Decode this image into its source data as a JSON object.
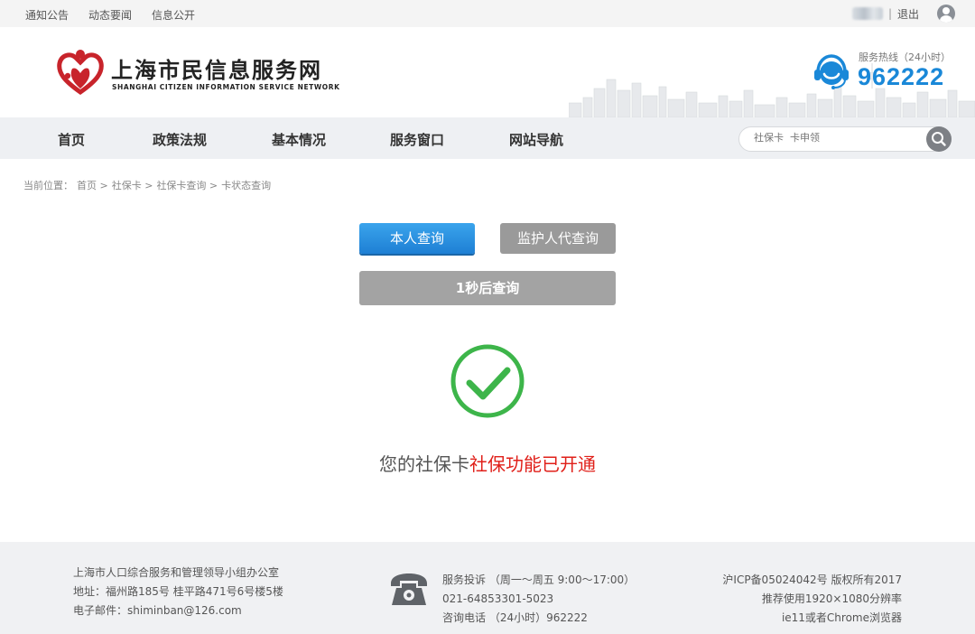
{
  "topbar": {
    "links": [
      "通知公告",
      "动态要闻",
      "信息公开"
    ],
    "separator": "|",
    "logout": "退出"
  },
  "header": {
    "title": "上海市民信息服务网",
    "subtitle": "SHANGHAI CITIZEN INFORMATION SERVICE NETWORK",
    "hotline_label": "服务热线（24小时）",
    "hotline_number": "962222"
  },
  "nav": {
    "items": [
      "首页",
      "政策法规",
      "基本情况",
      "服务窗口",
      "网站导航"
    ],
    "search_placeholder": "社保卡  卡申领"
  },
  "breadcrumb": {
    "prefix": "当前位置：",
    "items": [
      "首页 >",
      "社保卡 >",
      "社保卡查询 >",
      "卡状态查询"
    ]
  },
  "query": {
    "self_label": "本人查询",
    "guardian_label": "监护人代查询",
    "countdown_label": "1秒后查询"
  },
  "result": {
    "prefix": "您的社保卡",
    "highlight": "社保功能已开通"
  },
  "footer": {
    "left": [
      "上海市人口综合服务和管理领导小组办公室",
      "地址：福州路185号    桂平路471号6号楼5楼",
      "电子邮件：shiminban@126.com"
    ],
    "middle": [
      "服务投诉 （周一～周五 9:00～17:00）",
      "021-64853301-5023",
      "咨询电话 （24小时）962222"
    ],
    "right": [
      "沪ICP备05024042号 版权所有2017",
      "推荐使用1920×1080分辨率",
      "ie11或者Chrome浏览器"
    ]
  },
  "colors": {
    "brand_red": "#c8242b",
    "hotline_blue": "#1a88d8",
    "success_green": "#3db54a",
    "highlight_red": "#e0201a",
    "primary_button": "#1e7fd4"
  },
  "icons": [
    "logo-heart-icon",
    "headset-icon",
    "search-icon",
    "user-avatar-icon",
    "check-circle-icon",
    "telephone-icon"
  ]
}
